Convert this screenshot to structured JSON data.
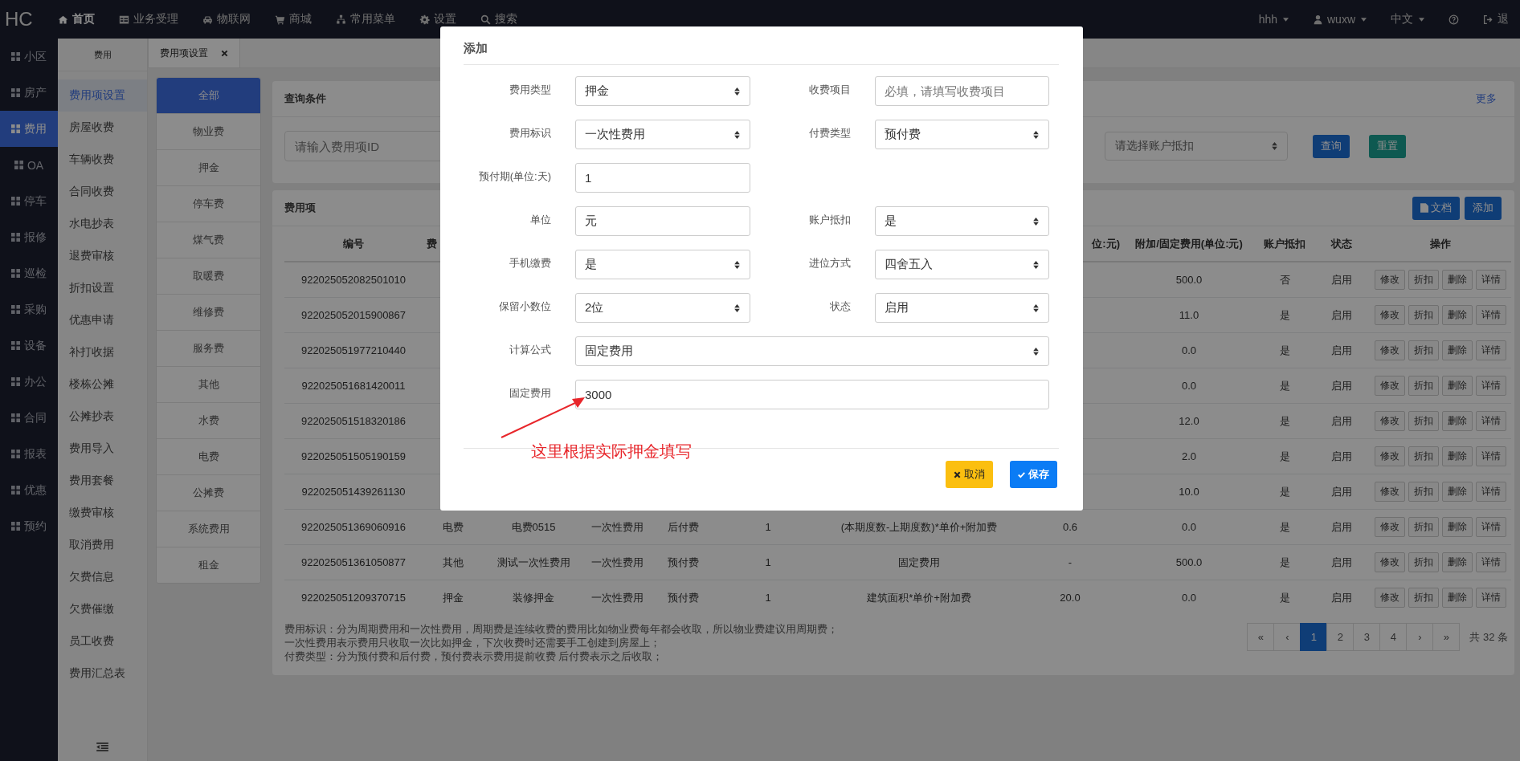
{
  "topbar": {
    "logo": "HC",
    "menu": [
      {
        "kind": "home",
        "label": "首页",
        "selected": true
      },
      {
        "kind": "table",
        "label": "业务受理",
        "selected": false
      },
      {
        "kind": "car",
        "label": "物联网",
        "selected": false
      },
      {
        "kind": "cart",
        "label": "商城",
        "selected": false
      },
      {
        "kind": "sitemap",
        "label": "常用菜单",
        "selected": false
      },
      {
        "kind": "gear",
        "label": "设置",
        "selected": false
      },
      {
        "kind": "search",
        "label": "搜索",
        "selected": false
      }
    ],
    "right": [
      {
        "kind": "text",
        "label": "hhh",
        "dropdown": true
      },
      {
        "kind": "user",
        "label": "wuxw",
        "dropdown": true
      },
      {
        "kind": "text",
        "label": "中文",
        "dropdown": true
      },
      {
        "kind": "help",
        "dropdown": false
      },
      {
        "kind": "logout",
        "label": "退",
        "dropdown": false
      }
    ]
  },
  "modules": [
    {
      "label": "小区",
      "selected": false
    },
    {
      "label": "房产",
      "selected": false
    },
    {
      "label": "费用",
      "selected": true
    },
    {
      "label": "OA",
      "selected": false
    },
    {
      "label": "停车",
      "selected": false
    },
    {
      "label": "报修",
      "selected": false
    },
    {
      "label": "巡检",
      "selected": false
    },
    {
      "label": "采购",
      "selected": false
    },
    {
      "label": "设备",
      "selected": false
    },
    {
      "label": "办公",
      "selected": false
    },
    {
      "label": "合同",
      "selected": false
    },
    {
      "label": "报表",
      "selected": false
    },
    {
      "label": "优惠",
      "selected": false
    },
    {
      "label": "预约",
      "selected": false
    }
  ],
  "submenu": {
    "title": "费用",
    "items": [
      {
        "label": "费用项设置",
        "selected": true
      },
      {
        "label": "房屋收费",
        "selected": false
      },
      {
        "label": "车辆收费",
        "selected": false
      },
      {
        "label": "合同收费",
        "selected": false
      },
      {
        "label": "水电抄表",
        "selected": false
      },
      {
        "label": "退费审核",
        "selected": false
      },
      {
        "label": "折扣设置",
        "selected": false
      },
      {
        "label": "优惠申请",
        "selected": false
      },
      {
        "label": "补打收据",
        "selected": false
      },
      {
        "label": "楼栋公摊",
        "selected": false
      },
      {
        "label": "公摊抄表",
        "selected": false
      },
      {
        "label": "费用导入",
        "selected": false
      },
      {
        "label": "费用套餐",
        "selected": false
      },
      {
        "label": "缴费审核",
        "selected": false
      },
      {
        "label": "取消费用",
        "selected": false
      },
      {
        "label": "欠费信息",
        "selected": false
      },
      {
        "label": "欠费催缴",
        "selected": false
      },
      {
        "label": "员工收费",
        "selected": false
      },
      {
        "label": "费用汇总表",
        "selected": false
      }
    ]
  },
  "tabs": [
    {
      "label": "费用项设置",
      "selected": true
    }
  ],
  "categories": [
    {
      "label": "全部",
      "selected": true
    },
    {
      "label": "物业费",
      "selected": false
    },
    {
      "label": "押金",
      "selected": false
    },
    {
      "label": "停车费",
      "selected": false
    },
    {
      "label": "煤气费",
      "selected": false
    },
    {
      "label": "取暖费",
      "selected": false
    },
    {
      "label": "维修费",
      "selected": false
    },
    {
      "label": "服务费",
      "selected": false
    },
    {
      "label": "其他",
      "selected": false
    },
    {
      "label": "水费",
      "selected": false
    },
    {
      "label": "电费",
      "selected": false
    },
    {
      "label": "公摊费",
      "selected": false
    },
    {
      "label": "系统费用",
      "selected": false
    },
    {
      "label": "租金",
      "selected": false
    }
  ],
  "query": {
    "title": "查询条件",
    "more": "更多",
    "id_placeholder": "请输入费用项ID",
    "deduct_placeholder": "请选择账户抵扣",
    "search_button": "查询",
    "reset_button": "重置"
  },
  "fee_table": {
    "title": "费用项",
    "doc_button": "文档",
    "add_button": "添加",
    "header": {
      "column_1": "编号",
      "column_2": "费",
      "column_8": "位:元)",
      "column_9": "附加/固定费用(单位:元)",
      "column_10": "账户抵扣",
      "column_11": "状态",
      "column_12": "操作"
    },
    "rows": [
      {
        "column_1": "922025052082501010",
        "column_9": "500.0",
        "column_10": "否",
        "column_11": "启用",
        "actions": [
          "修改",
          "折扣",
          "删除",
          "详情"
        ]
      },
      {
        "column_1": "922025052015900867",
        "column_9": "11.0",
        "column_10": "是",
        "column_11": "启用",
        "actions": [
          "修改",
          "折扣",
          "删除",
          "详情"
        ]
      },
      {
        "column_1": "922025051977210440",
        "column_9": "0.0",
        "column_10": "是",
        "column_11": "启用",
        "actions": [
          "修改",
          "折扣",
          "删除",
          "详情"
        ]
      },
      {
        "column_1": "922025051681420011",
        "column_9": "0.0",
        "column_10": "是",
        "column_11": "启用",
        "actions": [
          "修改",
          "折扣",
          "删除",
          "详情"
        ]
      },
      {
        "column_1": "922025051518320186",
        "column_9": "12.0",
        "column_10": "是",
        "column_11": "启用",
        "actions": [
          "修改",
          "折扣",
          "删除",
          "详情"
        ]
      },
      {
        "column_1": "922025051505190159",
        "column_9": "2.0",
        "column_10": "是",
        "column_11": "启用",
        "actions": [
          "修改",
          "折扣",
          "删除",
          "详情"
        ]
      },
      {
        "column_1": "922025051439261130",
        "column_9": "10.0",
        "column_10": "是",
        "column_11": "启用",
        "actions": [
          "修改",
          "折扣",
          "删除",
          "详情"
        ]
      },
      {
        "column_1": "922025051369060916",
        "column_2": "电费",
        "column_3": "电费0515",
        "column_4": "一次性费用",
        "column_5": "后付费",
        "column_6": "1",
        "column_7": "(本期度数-上期度数)*单价+附加费",
        "column_8": "0.6",
        "column_9": "0.0",
        "column_10": "是",
        "column_11": "启用",
        "actions": [
          "修改",
          "折扣",
          "删除",
          "详情"
        ]
      },
      {
        "column_1": "922025051361050877",
        "column_2": "其他",
        "column_3": "测试一次性费用",
        "column_4": "一次性费用",
        "column_5": "预付费",
        "column_6": "1",
        "column_7": "固定费用",
        "column_8": "-",
        "column_9": "500.0",
        "column_10": "是",
        "column_11": "启用",
        "actions": [
          "修改",
          "折扣",
          "删除",
          "详情"
        ]
      },
      {
        "column_1": "922025051209370715",
        "column_2": "押金",
        "column_3": "装修押金",
        "column_4": "一次性费用",
        "column_5": "预付费",
        "column_6": "1",
        "column_7": "建筑面积*单价+附加费",
        "column_8": "20.0",
        "column_9": "0.0",
        "column_10": "是",
        "column_11": "启用",
        "actions": [
          "修改",
          "折扣",
          "删除",
          "详情"
        ]
      }
    ],
    "notes": [
      "费用标识：分为周期费用和一次性费用，周期费是连续收费的费用比如物业费每年都会收取，所以物业费建议用周期费；",
      "一次性费用表示费用只收取一次比如押金，下次收费时还需要手工创建到房屋上；",
      "付费类型：分为预付费和后付费，预付费表示费用提前收费 后付费表示之后收取；"
    ],
    "pagination": {
      "pages": [
        {
          "label": "«",
          "selected": false
        },
        {
          "label": "‹",
          "selected": false
        },
        {
          "label": "1",
          "selected": true
        },
        {
          "label": "2",
          "selected": false
        },
        {
          "label": "3",
          "selected": false
        },
        {
          "label": "4",
          "selected": false
        },
        {
          "label": "›",
          "selected": false
        },
        {
          "label": "»",
          "selected": false
        }
      ],
      "total": "共 32 条"
    }
  },
  "dialog": {
    "title": "添加",
    "rows": [
      [
        {
          "label": "费用类型",
          "kind": "select",
          "value": "押金"
        },
        {
          "label": "收费项目",
          "kind": "input",
          "placeholder": "必填，请填写收费项目"
        }
      ],
      [
        {
          "label": "费用标识",
          "kind": "select",
          "value": "一次性费用"
        },
        {
          "label": "付费类型",
          "kind": "select",
          "value": "预付费"
        }
      ],
      [
        {
          "label": "预付期(单位:天)",
          "kind": "input",
          "value": "1"
        }
      ],
      [
        {
          "label": "单位",
          "kind": "input",
          "value": "元"
        },
        {
          "label": "账户抵扣",
          "kind": "select",
          "value": "是"
        }
      ],
      [
        {
          "label": "手机缴费",
          "kind": "select",
          "value": "是"
        },
        {
          "label": "进位方式",
          "kind": "select",
          "value": "四舍五入"
        }
      ],
      [
        {
          "label": "保留小数位",
          "kind": "select",
          "value": "2位"
        },
        {
          "label": "状态",
          "kind": "select",
          "value": "启用"
        }
      ],
      [
        {
          "label": "计算公式",
          "kind": "select",
          "value": "固定费用",
          "wide": true
        }
      ],
      [
        {
          "label": "固定费用",
          "kind": "input",
          "value": "3000",
          "wide": true
        }
      ]
    ],
    "annotation": "这里根据实际押金填写",
    "cancel_button": "取消",
    "save_button": "保存"
  }
}
